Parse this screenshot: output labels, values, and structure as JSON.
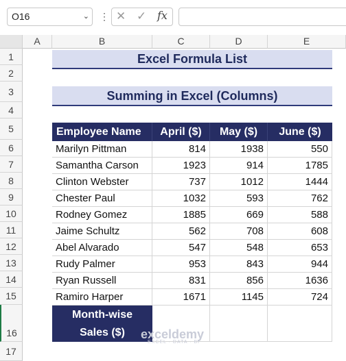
{
  "formula_bar": {
    "name_box": "O16",
    "fx_label": "fx",
    "formula": ""
  },
  "columns": [
    "A",
    "B",
    "C",
    "D",
    "E"
  ],
  "rows": [
    "1",
    "2",
    "3",
    "4",
    "5",
    "6",
    "7",
    "8",
    "9",
    "10",
    "11",
    "12",
    "13",
    "14",
    "15",
    "16",
    "17"
  ],
  "sheet": {
    "title": "Excel Formula List",
    "subtitle": "Summing in Excel (Columns)",
    "headers": [
      "Employee Name",
      "April ($)",
      "May ($)",
      "June ($)"
    ],
    "data": [
      {
        "name": "Marilyn Pittman",
        "april": "814",
        "may": "1938",
        "june": "550"
      },
      {
        "name": "Samantha Carson",
        "april": "1923",
        "may": "914",
        "june": "1785"
      },
      {
        "name": "Clinton Webster",
        "april": "737",
        "may": "1012",
        "june": "1444"
      },
      {
        "name": "Chester Paul",
        "april": "1032",
        "may": "593",
        "june": "762"
      },
      {
        "name": "Rodney Gomez",
        "april": "1885",
        "may": "669",
        "june": "588"
      },
      {
        "name": "Jaime Schultz",
        "april": "562",
        "may": "708",
        "june": "608"
      },
      {
        "name": "Abel Alvarado",
        "april": "547",
        "may": "548",
        "june": "653"
      },
      {
        "name": "Rudy Palmer",
        "april": "953",
        "may": "843",
        "june": "944"
      },
      {
        "name": "Ryan Russell",
        "april": "831",
        "may": "856",
        "june": "1636"
      },
      {
        "name": "Ramiro Harper",
        "april": "1671",
        "may": "1145",
        "june": "724"
      }
    ],
    "sum_label_line1": "Month-wise",
    "sum_label_line2": "Sales ($)"
  },
  "watermark": {
    "brand": "exceldemy",
    "tagline": "EXCEL · DATA · BI"
  },
  "colors": {
    "header_fill": "#262d63",
    "title_fill": "#d9ddf0"
  }
}
